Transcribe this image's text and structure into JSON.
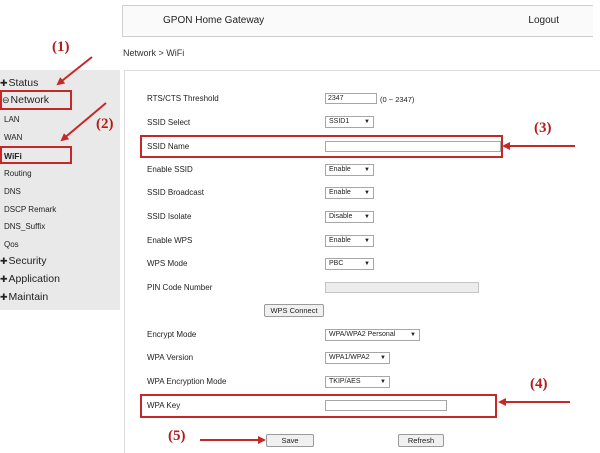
{
  "header": {
    "title": "GPON Home Gateway",
    "logout": "Logout"
  },
  "breadcrumb": "Network > WiFi",
  "sidebar": {
    "status": "Status",
    "network": "Network",
    "lan": "LAN",
    "wan": "WAN",
    "wifi": "WiFi",
    "routing": "Routing",
    "dns": "DNS",
    "dscp": "DSCP Remark",
    "dns_suffix": "DNS_Suffix",
    "qos": "Qos",
    "security": "Security",
    "application": "Application",
    "maintain": "Maintain"
  },
  "form": {
    "rts_label": "RTS/CTS Threshold",
    "rts_value": "2347",
    "rts_hint": "(0 ~ 2347)",
    "ssid_select_label": "SSID Select",
    "ssid_select_value": "SSID1",
    "ssid_name_label": "SSID Name",
    "ssid_name_value": "",
    "enable_ssid_label": "Enable SSID",
    "enable_ssid_value": "Enable",
    "ssid_broadcast_label": "SSID Broadcast",
    "ssid_broadcast_value": "Enable",
    "ssid_isolate_label": "SSID Isolate",
    "ssid_isolate_value": "Disable",
    "enable_wps_label": "Enable WPS",
    "enable_wps_value": "Enable",
    "wps_mode_label": "WPS Mode",
    "wps_mode_value": "PBC",
    "pin_label": "PIN Code Number",
    "pin_value": "",
    "wps_connect": "WPS Connect",
    "encrypt_mode_label": "Encrypt Mode",
    "encrypt_mode_value": "WPA/WPA2 Personal",
    "wpa_version_label": "WPA Version",
    "wpa_version_value": "WPA1/WPA2",
    "wpa_enc_mode_label": "WPA Encryption Mode",
    "wpa_enc_mode_value": "TKIP/AES",
    "wpa_key_label": "WPA Key",
    "wpa_key_value": ""
  },
  "buttons": {
    "save": "Save",
    "refresh": "Refresh"
  },
  "markers": {
    "m1": "(1)",
    "m2": "(2)",
    "m3": "(3)",
    "m4": "(4)",
    "m5": "(5)"
  },
  "colors": {
    "annotation": "#c62828",
    "sidebar_bg": "#e9e9e9"
  }
}
